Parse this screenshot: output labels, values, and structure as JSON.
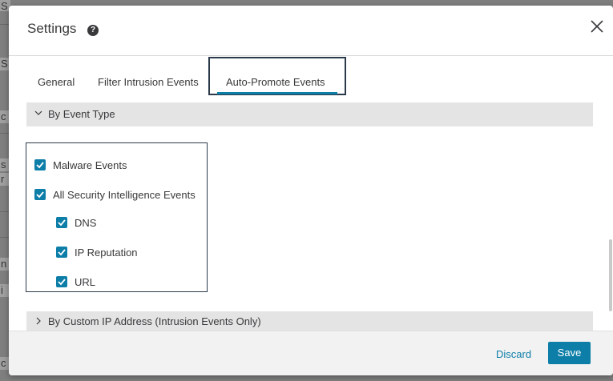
{
  "dialog": {
    "title": "Settings",
    "help_icon": "help-circle-icon",
    "close_icon": "close-icon"
  },
  "tabs": [
    {
      "label": "General",
      "active": false
    },
    {
      "label": "Filter Intrusion Events",
      "active": false
    },
    {
      "label": "Auto-Promote Events",
      "active": true
    }
  ],
  "sections": {
    "event_type": {
      "label": "By Event Type",
      "expanded": true
    },
    "custom_ip": {
      "label": "By Custom IP Address (Intrusion Events Only)",
      "expanded": false
    }
  },
  "checkboxes": {
    "malware": {
      "label": "Malware Events",
      "checked": true
    },
    "security_intel": {
      "label": "All Security Intelligence Events",
      "checked": true
    },
    "dns": {
      "label": "DNS",
      "checked": true
    },
    "ip_reputation": {
      "label": "IP Reputation",
      "checked": true
    },
    "url": {
      "label": "URL",
      "checked": true
    }
  },
  "footer": {
    "discard_label": "Discard",
    "save_label": "Save"
  },
  "background_fragments": [
    "S",
    "S",
    "c",
    "s",
    "r",
    "n",
    "i",
    "c"
  ],
  "colors": {
    "accent": "#0d7ea8",
    "text": "#39393b",
    "section_bg": "#e4e4e5",
    "footer_bg": "#f2f2f2"
  }
}
